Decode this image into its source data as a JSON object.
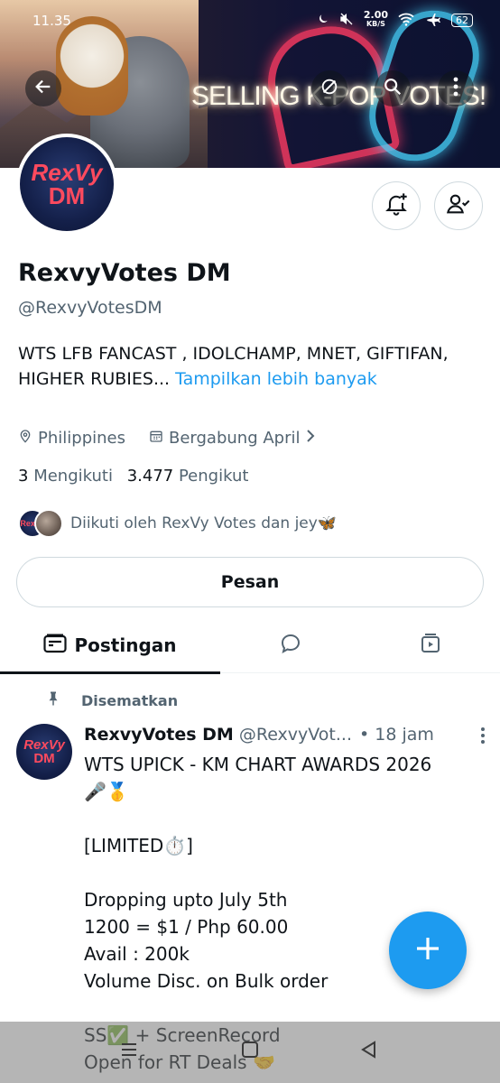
{
  "status_bar": {
    "time": "11.35",
    "speed_value": "2.00",
    "speed_unit": "KB/S",
    "battery": "62"
  },
  "banner": {
    "text": "SELLING K-POP VOTES!"
  },
  "profile": {
    "avatar_line1": "RexVy",
    "avatar_line2": "DM",
    "name": "RexvyVotes DM",
    "handle": "@RexvyVotesDM",
    "bio": "WTS LFB FANCAST , IDOLCHAMP, MNET, GIFTIFAN, HIGHER RUBIES...",
    "bio_more": "Tampilkan lebih banyak",
    "location": "Philippines",
    "joined": "Bergabung April",
    "following_count": "3",
    "following_label": "Mengikuti",
    "followers_count": "3.477",
    "followers_label": "Pengikut",
    "followed_by": "Diikuti oleh RexVy Votes dan jey🦋",
    "mini_avatar_text": "RexVy"
  },
  "buttons": {
    "message": "Pesan"
  },
  "tabs": {
    "posts": "Postingan"
  },
  "pinned_label": "Disematkan",
  "post": {
    "avatar_line1": "RexVy",
    "avatar_line2": "DM",
    "name": "RexvyVotes DM",
    "handle": "@RexvyVot...",
    "time": "• 18 jam",
    "text": "WTS UPICK - KM CHART AWARDS 2026\n🎤🥇\n\n[LIMITED⏱️]\n\nDropping upto July 5th\n1200    = $1 / Php 60.00\nAvail : 200k\nVolume Disc. on Bulk order\n\nSS✅ + ScreenRecord\nOpen for RT Deals 🤝"
  },
  "colors": {
    "accent": "#1d9bf0",
    "text_primary": "#0f1419",
    "text_secondary": "#536471",
    "border": "#cfd9de"
  }
}
